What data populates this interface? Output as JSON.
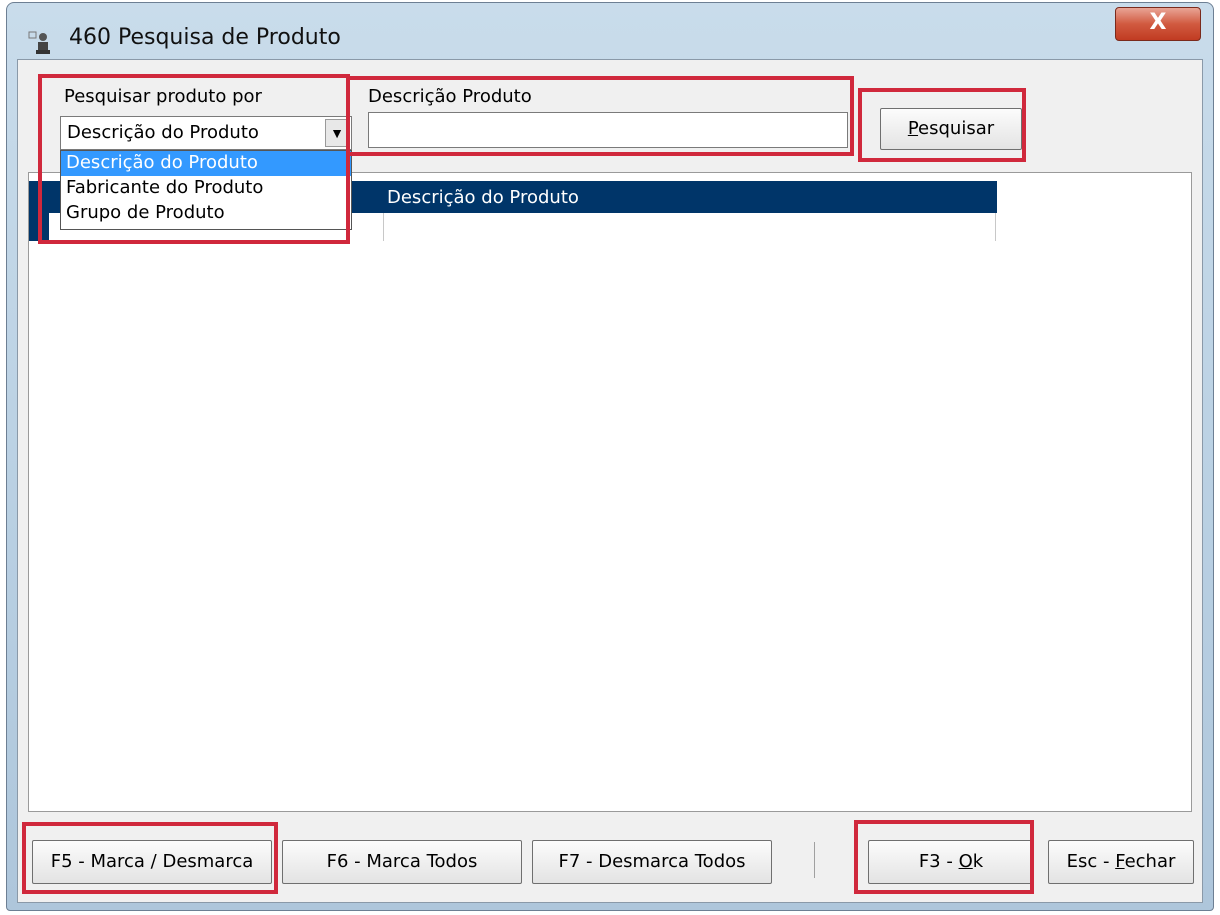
{
  "window": {
    "title": "460 Pesquisa de Produto",
    "close_glyph": "X"
  },
  "search": {
    "search_by_label": "Pesquisar produto por",
    "search_by_selected": "Descrição do Produto",
    "options": [
      "Descrição do Produto",
      "Fabricante do Produto",
      "Grupo de Produto"
    ],
    "description_label": "Descrição Produto",
    "description_value": "",
    "search_button_mnemonic": "P",
    "search_button_rest": "esquisar"
  },
  "grid": {
    "column_header": "Descrição do Produto"
  },
  "buttons": {
    "toggle_mark": "F5 - Marca / Desmarca",
    "mark_all": "F6 - Marca Todos",
    "unmark_all": "F7 - Desmarca Todos",
    "ok_prefix": "F3 - ",
    "ok_mnemonic": "O",
    "ok_rest": "k",
    "close_prefix": "Esc - ",
    "close_mnemonic": "F",
    "close_rest": "echar"
  },
  "icons": {
    "app": "search-person-icon",
    "dropdown": "chevron-down-icon",
    "close": "close-icon"
  },
  "colors": {
    "highlight": "#d0283c",
    "grid_header": "#003569",
    "selection": "#3399ff"
  }
}
